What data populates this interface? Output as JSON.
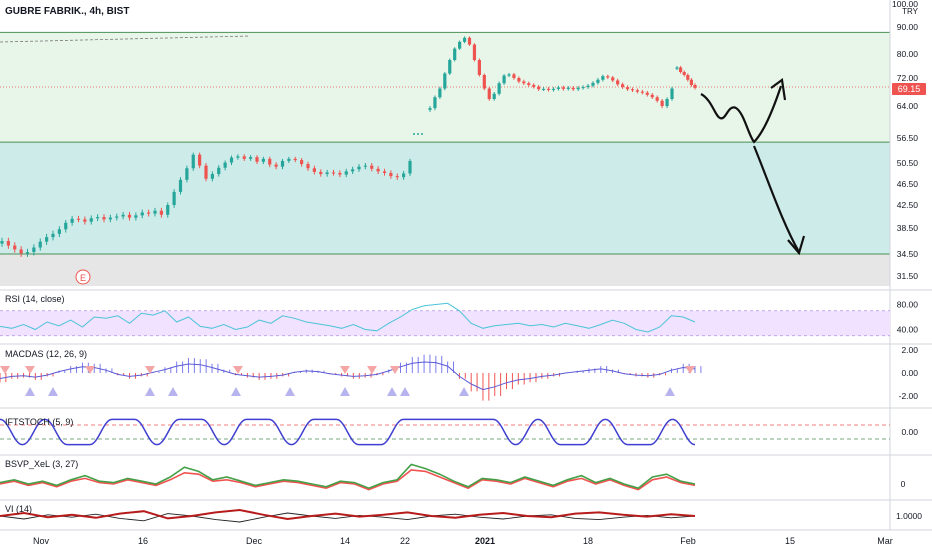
{
  "header": {
    "title": "GUBRE FABRIK., 4h, BIST"
  },
  "colors": {
    "up": "#26a69a",
    "down": "#ef5350",
    "green_zone": "#e8f5e9",
    "teal_zone": "#cdece9",
    "gray_zone": "#e6e6e6",
    "price_badge": "#ef5350",
    "rsi_line": "#4cc3d9",
    "rsi_band": "#f1e3ff",
    "macd_pos": "#7b7bee",
    "macd_neg": "#ef5350",
    "stoch": "#3f3fd1",
    "bsvp_green": "#43a047",
    "bsvp_red": "#ef5350",
    "vi_red": "#b71c1c",
    "vi_black": "#222222"
  },
  "chart_data": [
    {
      "type": "candlestick",
      "title": "GUBRE FABRIK., 4h, BIST",
      "currency": "TRY",
      "y_axis_ticks": [
        "100.00",
        "90.00",
        "80.00",
        "72.00",
        "64.00",
        "56.50",
        "50.50",
        "46.50",
        "42.50",
        "38.50",
        "34.50",
        "31.50"
      ],
      "last_price": "69.15",
      "x_ticks": [
        "Nov",
        "16",
        "Dec",
        "14",
        "22",
        "2021",
        "18",
        "Feb",
        "15",
        "Mar"
      ],
      "zones": [
        {
          "name": "green",
          "from": 55.5,
          "to": 88
        },
        {
          "name": "teal",
          "from": 34.5,
          "to": 55.5
        },
        {
          "name": "gray",
          "from": 30,
          "to": 34.5
        }
      ],
      "close_path": [
        36.5,
        35.8,
        35.2,
        34.6,
        34.8,
        35.5,
        36.4,
        37.1,
        37.6,
        38.3,
        39.4,
        40.1,
        40.0,
        39.6,
        40.2,
        40.4,
        40.0,
        40.3,
        40.5,
        40.8,
        40.3,
        40.7,
        41.2,
        41.0,
        41.5,
        40.8,
        42.5,
        45.0,
        47.3,
        49.5,
        52.5,
        50.0,
        47.5,
        48.4,
        49.6,
        50.6,
        51.8,
        52.1,
        51.5,
        51.9,
        50.8,
        51.5,
        50.2,
        49.8,
        51.0,
        51.5,
        51.2,
        50.3,
        49.5,
        48.8,
        48.4,
        48.7,
        48.6,
        48.3,
        48.9,
        49.3,
        49.8,
        50.0,
        49.4,
        48.9,
        48.6,
        48.0,
        47.8,
        48.5,
        51.0
      ],
      "close_path_2": [
        63.5,
        66.5,
        69.0,
        73.5,
        78.0,
        82.0,
        84.5,
        86.0,
        83.5,
        78.0,
        73.0,
        69.0,
        66.0,
        67.5,
        70.5,
        72.8,
        73.2,
        72.0,
        71.0,
        70.5,
        70.0,
        69.5,
        68.8,
        68.9,
        68.6,
        68.9,
        69.3,
        68.9,
        69.2,
        68.8,
        69.2,
        69.4,
        69.8,
        70.6,
        71.5,
        72.6,
        72.2,
        71.3,
        70.2,
        69.4,
        68.8,
        68.5,
        68.1,
        67.8,
        67.2,
        66.5,
        65.5,
        64.0,
        66.0,
        69.0
      ],
      "close_path_3": [
        75.5,
        74.0,
        73.0,
        71.5,
        70.0,
        69.2
      ],
      "drawn_arrows": [
        {
          "name": "up-arrow-drawing",
          "target": "rise toward 72"
        },
        {
          "name": "down-arrow-drawing",
          "target": "fall toward 34.50"
        }
      ],
      "markers": [
        "E"
      ]
    },
    {
      "type": "line",
      "name": "RSI (14, close)",
      "y_ticks": [
        "80.00",
        "40.00"
      ],
      "values": [
        45,
        42,
        48,
        40,
        52,
        46,
        55,
        44,
        60,
        58,
        62,
        50,
        66,
        63,
        70,
        52,
        60,
        45,
        42,
        48,
        40,
        44,
        55,
        50,
        62,
        58,
        52,
        49,
        46,
        42,
        48,
        40,
        38,
        50,
        60,
        72,
        78,
        80,
        82,
        70,
        50,
        42,
        46,
        48,
        50,
        46,
        48,
        44,
        50,
        46,
        42,
        48,
        55,
        50,
        40,
        36,
        44,
        62,
        60,
        52
      ]
    },
    {
      "type": "bar",
      "name": "MACDAS (12, 26, 9)",
      "y_ticks": [
        "2.00",
        "0.00",
        "-2.00"
      ],
      "values": [
        -0.8,
        -0.5,
        -0.4,
        -0.6,
        -0.3,
        0.2,
        0.6,
        0.9,
        0.8,
        0.4,
        -0.2,
        -0.5,
        -0.3,
        0.1,
        0.5,
        1.0,
        1.3,
        1.2,
        0.8,
        0.3,
        -0.2,
        -0.4,
        -0.6,
        -0.5,
        -0.3,
        0.1,
        0.3,
        0.2,
        -0.1,
        -0.3,
        -0.5,
        -0.4,
        -0.2,
        0.3,
        0.9,
        1.4,
        1.6,
        1.5,
        1.0,
        -0.5,
        -1.6,
        -2.4,
        -2.0,
        -1.4,
        -1.0,
        -0.8,
        -0.5,
        -0.3,
        0.0,
        0.2,
        0.4,
        0.6,
        0.3,
        -0.1,
        -0.3,
        -0.4,
        -0.2,
        0.4,
        0.8,
        0.6
      ]
    },
    {
      "type": "line",
      "name": "IFTSTOCH (5, 9)",
      "y_ticks": [
        "0.00"
      ],
      "values": [
        0.9,
        -0.9,
        0.9,
        -0.9,
        -0.9,
        0.9,
        0.9,
        -0.9,
        0.9,
        0.9,
        -0.9,
        0.9,
        0.9,
        -0.9,
        0.9,
        0.9,
        -0.9,
        -0.9,
        0.9,
        0.9,
        0.9,
        0.9,
        0.9,
        -0.9,
        0.9,
        -0.9,
        -0.9,
        0.9,
        -0.9,
        -0.9,
        0.9,
        -0.9
      ]
    },
    {
      "type": "line",
      "name": "BSVP_XeL (3, 27)",
      "y_ticks": [
        "0"
      ],
      "series": [
        {
          "name": "",
          "values": [
            0.1,
            0.3,
            0.0,
            0.2,
            -0.1,
            0.3,
            0.6,
            0.2,
            0.1,
            0.4,
            0.2,
            0.0,
            0.5,
            1.2,
            0.9,
            0.3,
            0.5,
            0.2,
            -0.1,
            0.1,
            0.3,
            0.2,
            0.0,
            -0.2,
            0.2,
            0.1,
            -0.3,
            0.1,
            0.3,
            1.4,
            1.1,
            0.7,
            0.2,
            -0.2,
            0.4,
            0.3,
            0.1,
            0.5,
            0.2,
            -0.1,
            0.3,
            0.6,
            0.1,
            0.4,
            0.0,
            -0.3,
            0.5,
            0.7,
            0.2,
            0.0
          ]
        },
        {
          "name": "",
          "values": [
            0.0,
            0.2,
            -0.1,
            0.1,
            -0.2,
            0.2,
            0.4,
            0.1,
            0.0,
            0.3,
            0.1,
            -0.1,
            0.3,
            0.8,
            0.7,
            0.2,
            0.3,
            0.1,
            -0.2,
            0.0,
            0.2,
            0.1,
            -0.1,
            -0.3,
            0.1,
            0.0,
            -0.4,
            0.0,
            0.2,
            1.0,
            0.9,
            0.5,
            0.1,
            -0.3,
            0.3,
            0.2,
            0.0,
            0.4,
            0.1,
            -0.2,
            0.2,
            0.4,
            0.0,
            0.3,
            -0.1,
            -0.4,
            0.3,
            0.5,
            0.1,
            -0.1
          ]
        }
      ]
    },
    {
      "type": "line",
      "name": "VI (14)",
      "y_ticks": [
        "1.0000"
      ],
      "series": [
        {
          "name": "",
          "values": [
            1.0,
            1.05,
            0.98,
            1.02,
            0.97,
            1.04,
            1.08,
            0.96,
            1.0,
            1.06,
            1.1,
            1.02,
            0.95,
            1.0,
            1.04,
            0.99,
            1.02,
            1.06,
            1.0,
            0.97,
            1.02,
            1.05,
            1.0,
            0.98,
            1.04,
            1.06,
            1.02,
            0.99,
            1.03,
            1.0
          ]
        },
        {
          "name": "",
          "values": [
            1.0,
            0.95,
            1.02,
            0.98,
            1.03,
            0.96,
            0.92,
            1.04,
            1.0,
            0.94,
            0.9,
            0.98,
            1.05,
            1.0,
            0.96,
            1.01,
            0.98,
            0.94,
            1.0,
            1.03,
            0.98,
            0.95,
            1.0,
            1.02,
            0.96,
            0.94,
            0.98,
            1.01,
            0.97,
            1.0
          ]
        }
      ]
    }
  ]
}
